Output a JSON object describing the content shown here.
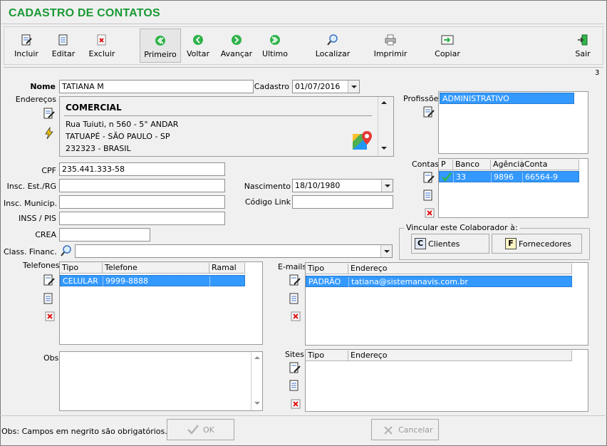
{
  "window": {
    "title": "CADASTRO DE CONTATOS",
    "page_number": "3"
  },
  "toolbar": [
    {
      "label": "Incluir",
      "icon": "add-doc-icon"
    },
    {
      "label": "Editar",
      "icon": "edit-doc-icon"
    },
    {
      "label": "Excluir",
      "icon": "delete-doc-icon"
    },
    {
      "label": "Primeiro",
      "icon": "first-icon"
    },
    {
      "label": "Voltar",
      "icon": "back-icon"
    },
    {
      "label": "Avançar",
      "icon": "forward-icon"
    },
    {
      "label": "Ultimo",
      "icon": "last-icon"
    },
    {
      "label": "Localizar",
      "icon": "search-icon"
    },
    {
      "label": "Imprimir",
      "icon": "printer-icon"
    },
    {
      "label": "Copiar",
      "icon": "copy-icon"
    },
    {
      "label": "Sair",
      "icon": "exit-icon"
    }
  ],
  "form": {
    "nome_label": "Nome",
    "nome_value": "TATIANA M",
    "cadastro_label": "Cadastro",
    "cadastro_value": "01/07/2016",
    "enderecos_label": "Endereços",
    "address": {
      "type": "COMERCIAL",
      "line1": "Rua Tuiuti, n 560 - 5° ANDAR",
      "line2": "TATUAPÉ - SÃO PAULO - SP",
      "line3": "232323 - BRASIL"
    },
    "cpf_label": "CPF",
    "cpf_value": "235.441.333-58",
    "insc_est_label": "Insc. Est./RG",
    "insc_est_value": "",
    "insc_mun_label": "Insc. Municip.",
    "insc_mun_value": "",
    "inss_label": "INSS / PIS",
    "inss_value": "",
    "crea_label": "CREA",
    "crea_value": "",
    "class_fin_label": "Class. Financ.",
    "class_fin_value": "",
    "nascimento_label": "Nascimento",
    "nascimento_value": "18/10/1980",
    "codigo_link_label": "Código Link",
    "codigo_link_value": "",
    "profissoes_label": "Profissões",
    "profissao_selected": "ADMINISTRATIVO",
    "contas_label": "Contas",
    "contas_headers": [
      "P",
      "Banco",
      "Agência",
      "Conta"
    ],
    "contas_rows": [
      {
        "banco": "33",
        "agencia": "9896",
        "conta": "66564-9"
      }
    ],
    "vincular_label": "Vincular este Colaborador à:",
    "clientes_button": "Clientes",
    "clientes_key": "C",
    "fornecedores_button": "Fornecedores",
    "fornecedores_key": "F",
    "telefones_label": "Telefones",
    "telefones_headers": [
      "Tipo",
      "Telefone",
      "Ramal"
    ],
    "telefones_rows": [
      {
        "tipo": "CELULAR",
        "telefone": "9999-8888",
        "ramal": ""
      }
    ],
    "emails_label": "E-mails",
    "emails_headers": [
      "Tipo",
      "Endereço"
    ],
    "emails_rows": [
      {
        "tipo": "PADRÃO",
        "endereco": "tatiana@sistemanavis.com.br"
      }
    ],
    "obs_label": "Obs",
    "obs_value": "",
    "sites_label": "Sites",
    "sites_headers": [
      "Tipo",
      "Endereço"
    ]
  },
  "footer": {
    "note": "Obs: Campos em negrito são obrigatórios.",
    "ok_button": "OK",
    "cancel_button": "Cancelar"
  },
  "colors": {
    "title": "#1a9a35",
    "selection": "#3399ff"
  }
}
